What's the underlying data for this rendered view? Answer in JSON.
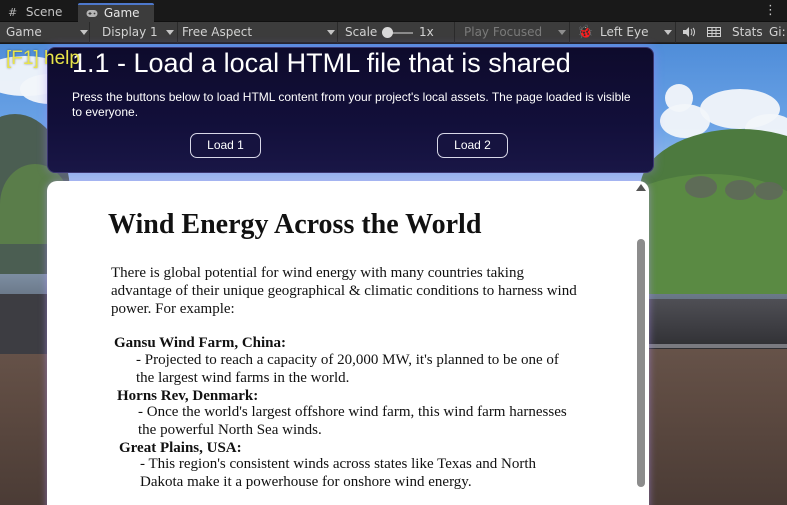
{
  "tabs": {
    "scene": {
      "icon": "grid-icon",
      "label": "Scene"
    },
    "game": {
      "icon": "gamepad-icon",
      "label": "Game"
    },
    "menu_icon": "kebab-menu-icon"
  },
  "toolbar": {
    "display_mode": "Game",
    "display": "Display 1",
    "aspect": "Free Aspect",
    "scale_label": "Scale",
    "scale_value": "1x",
    "play_mode": "Play Focused",
    "eye_icon": "bug-icon",
    "eye": "Left Eye",
    "audio_icon": "speaker-icon",
    "grid_icon": "grid-icon",
    "stats": "Stats",
    "gizmos": "Gi:"
  },
  "overlay": {
    "help": "[F1] help"
  },
  "header_panel": {
    "title": "1.1 - Load a local HTML file that is shared",
    "description": "Press the buttons below to load HTML content from your project's local assets. The page loaded is visible to everyone.",
    "load1": "Load 1",
    "load2": "Load 2"
  },
  "web_page": {
    "heading": "Wind Energy Across the World",
    "intro": "There is global potential for wind energy with many countries taking advantage of their unique geographical & climatic conditions to harness wind power. For example:",
    "items": [
      {
        "title": "Gansu Wind Farm, China:",
        "desc": "- Projected to reach a capacity of 20,000 MW, it's planned to be one of the largest wind farms in the world."
      },
      {
        "title": "Horns Rev, Denmark:",
        "desc": "- Once the world's largest offshore wind farm, this wind farm harnesses the powerful North Sea winds."
      },
      {
        "title": "Great Plains, USA:",
        "desc": "- This region's consistent winds across states like Texas and North Dakota make it a powerhouse for onshore wind energy."
      }
    ]
  },
  "colors": {
    "accent_tab": "#4d78cc",
    "help_text": "#e8e44a",
    "header_bg": "#120f3a"
  }
}
